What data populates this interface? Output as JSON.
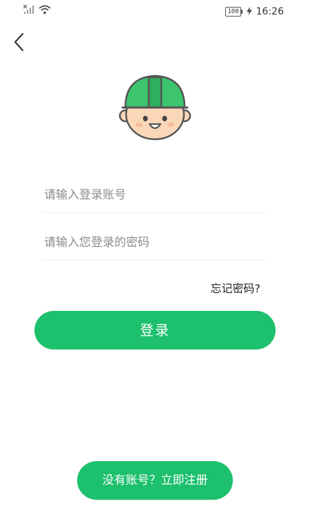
{
  "status_bar": {
    "battery": "100",
    "time": "16:26",
    "icons": [
      "signal-icon",
      "wifi-icon",
      "battery-icon",
      "charging-icon"
    ]
  },
  "header": {
    "back_icon": "chevron-left-icon"
  },
  "avatar": {
    "icon": "worker-helmet-avatar",
    "helmet_color": "#3cc46e"
  },
  "form": {
    "account_placeholder": "请输入登录账号",
    "password_placeholder": "请输入您登录的密码",
    "forgot_label": "忘记密码?",
    "login_label": "登录"
  },
  "footer": {
    "register_label": "没有账号？立即注册"
  },
  "colors": {
    "accent": "#1dc06d",
    "divider": "#eeeeee",
    "placeholder": "#8c8c8c"
  }
}
